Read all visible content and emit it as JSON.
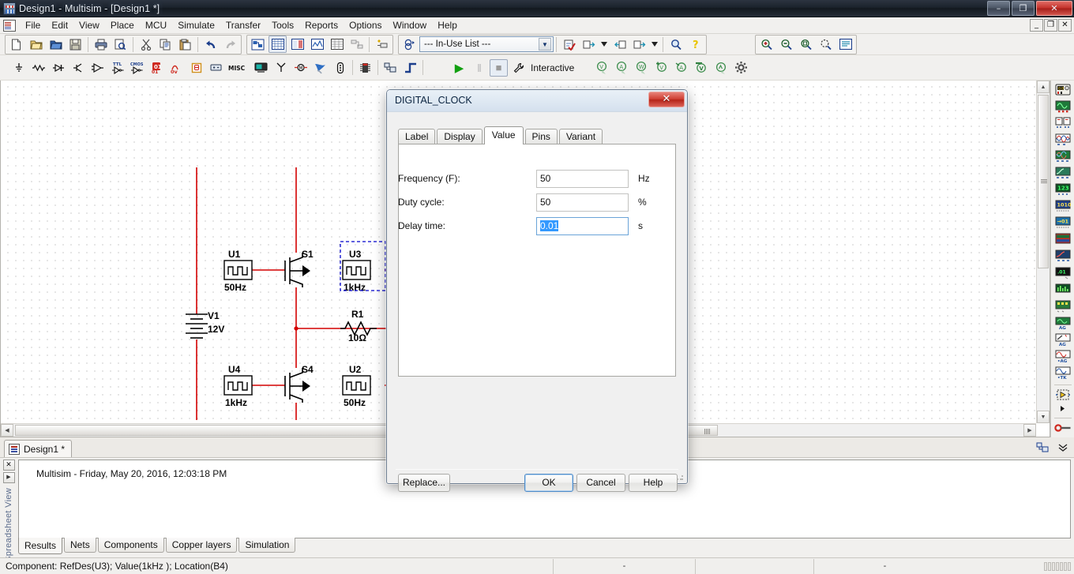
{
  "window": {
    "title": "Design1 - Multisim - [Design1 *]",
    "app_icon": "multisim-icon",
    "controls": {
      "minimize": "–",
      "restore": "❐",
      "close": "✕"
    },
    "mdi_controls": {
      "minimize": "_",
      "restore": "❐",
      "close": "✕"
    }
  },
  "menubar": {
    "items": [
      {
        "label": "File",
        "mnemonic": "F"
      },
      {
        "label": "Edit",
        "mnemonic": "E"
      },
      {
        "label": "View",
        "mnemonic": "V"
      },
      {
        "label": "Place",
        "mnemonic": "P"
      },
      {
        "label": "MCU",
        "mnemonic": "M"
      },
      {
        "label": "Simulate",
        "mnemonic": "S"
      },
      {
        "label": "Transfer",
        "mnemonic": "n"
      },
      {
        "label": "Tools",
        "mnemonic": "T"
      },
      {
        "label": "Reports",
        "mnemonic": "R"
      },
      {
        "label": "Options",
        "mnemonic": "O"
      },
      {
        "label": "Window",
        "mnemonic": "W"
      },
      {
        "label": "Help",
        "mnemonic": "H"
      }
    ]
  },
  "toolbar_standard": {
    "buttons": [
      "new-file-icon",
      "open-file-icon",
      "open-design-icon",
      "save-icon",
      "print-icon",
      "print-preview-icon",
      "cut-icon",
      "copy-icon",
      "paste-icon",
      "undo-icon",
      "redo-icon"
    ],
    "view_buttons": [
      "design-toolbox-icon",
      "spreadsheet-view-icon",
      "sp ice-netlist-icon",
      "grapher-icon",
      "postprocessor-icon",
      "parts-icon",
      "electrical-rules-check-icon"
    ]
  },
  "toolbar_components": {
    "buttons": [
      "source-icon",
      "basic-icon",
      "diode-icon",
      "transistor-icon",
      "analog-icon",
      "ttl-icon",
      "cmos-icon",
      "misc-digital-icon",
      "mixed-icon",
      "indicator-icon",
      "power-icon",
      "misc-icon",
      "advanced-peripheral-icon",
      "rf-icon",
      "electromechanical-icon",
      "ni-components-icon",
      "connector-icon",
      "mcu-icon",
      "hierarchical-block-icon",
      "bus-icon"
    ]
  },
  "inuse_list": {
    "label": "--- In-Use List ---",
    "name": "in-use-list-dropdown",
    "options": [
      "--- In-Use List ---"
    ]
  },
  "toolbar_right": {
    "buttons": [
      "erc-icon",
      "export-to-pcb-icon",
      "import-icon",
      "forward-annotate-icon",
      "find-icon",
      "help-icon"
    ]
  },
  "toolbar_zoom": {
    "buttons": [
      "zoom-in-icon",
      "zoom-out-icon",
      "zoom-area-icon",
      "zoom-fit-icon",
      "zoom-selection-icon"
    ]
  },
  "simulation_bar": {
    "run_label": "▶",
    "pause_label": "‖",
    "stop_label": "■",
    "mode_label": "Interactive",
    "mode_icon": "wrench-icon",
    "probe_buttons": [
      "voltage-probe-icon",
      "current-probe-icon",
      "power-probe-icon",
      "differential-voltage-probe-icon",
      "differential-current-probe-icon",
      "reference-voltage-probe-icon",
      "digital-probe-icon",
      "probe-settings-icon"
    ]
  },
  "instrument_sidebar": {
    "items": [
      "multimeter-icon",
      "function-generator-icon",
      "wattmeter-icon",
      "oscilloscope-icon",
      "four-channel-oscilloscope-icon",
      "bode-plotter-icon",
      "frequency-counter-icon",
      "word-generator-icon",
      "logic-converter-icon",
      "logic-analyzer-icon",
      "iv-analyzer-icon",
      "distortion-analyzer-icon",
      "spectrum-analyzer-icon",
      "network-analyzer-icon",
      "agilent-function-generator-icon",
      "agilent-multimeter-icon",
      "agilent-oscilloscope-icon",
      "tektronix-oscilloscope-icon",
      "labview-instruments-icon",
      "ni-elvis-icon",
      "current-clamp-icon"
    ]
  },
  "document_tab": {
    "label": "Design1 *",
    "icon": "schematic-icon"
  },
  "schematic": {
    "components": [
      {
        "ref": "U1",
        "value": "50Hz",
        "type": "digital-clock"
      },
      {
        "ref": "S1",
        "value": "",
        "type": "switch-mosfet"
      },
      {
        "ref": "U3",
        "value": "1kHz",
        "type": "digital-clock",
        "selected": true
      },
      {
        "ref": "V1",
        "value": "12V",
        "type": "dc-source"
      },
      {
        "ref": "R1",
        "value": "10Ω",
        "type": "resistor"
      },
      {
        "ref": "U4",
        "value": "1kHz",
        "type": "digital-clock"
      },
      {
        "ref": "S4",
        "value": "",
        "type": "switch-mosfet"
      },
      {
        "ref": "U2",
        "value": "50Hz",
        "type": "digital-clock"
      }
    ],
    "wire_color": "#d40000",
    "selection_color": "#0000cc"
  },
  "spreadsheet": {
    "panel_label": "Spreadsheet View",
    "close_label": "✕",
    "expand_label": "▶",
    "log_entry": "Multisim  -  Friday, May 20, 2016, 12:03:18 PM",
    "tabs": [
      {
        "label": "Results",
        "active": true
      },
      {
        "label": "Nets",
        "active": false
      },
      {
        "label": "Components",
        "active": false
      },
      {
        "label": "Copper layers",
        "active": false
      },
      {
        "label": "Simulation",
        "active": false
      }
    ]
  },
  "statusbar": {
    "message": "Component: RefDes(U3); Value(1kHz ); Location(B4)",
    "cells": [
      "-",
      "",
      "-"
    ]
  },
  "dialog": {
    "title": "DIGITAL_CLOCK",
    "close_label": "✕",
    "tabs": [
      {
        "label": "Label",
        "active": false
      },
      {
        "label": "Display",
        "active": false
      },
      {
        "label": "Value",
        "active": true
      },
      {
        "label": "Pins",
        "active": false
      },
      {
        "label": "Variant",
        "active": false
      }
    ],
    "fields": [
      {
        "label": "Frequency (F):",
        "value": "50",
        "unit": "Hz",
        "focused": false,
        "selected": false
      },
      {
        "label": "Duty cycle:",
        "value": "50",
        "unit": "%",
        "focused": false,
        "selected": false
      },
      {
        "label": "Delay time:",
        "value": "0.01",
        "unit": "s",
        "focused": true,
        "selected": true
      }
    ],
    "buttons": [
      {
        "label": "Replace...",
        "default": false
      },
      {
        "label": "OK",
        "default": true
      },
      {
        "label": "Cancel",
        "default": false
      },
      {
        "label": "Help",
        "default": false
      }
    ]
  },
  "colors": {
    "accent_blue": "#3399ff",
    "wire_red": "#d40000",
    "selection_blue": "#0000cc",
    "title_dark": "#1b222c",
    "dialog_bg": "#f0f0f0"
  }
}
